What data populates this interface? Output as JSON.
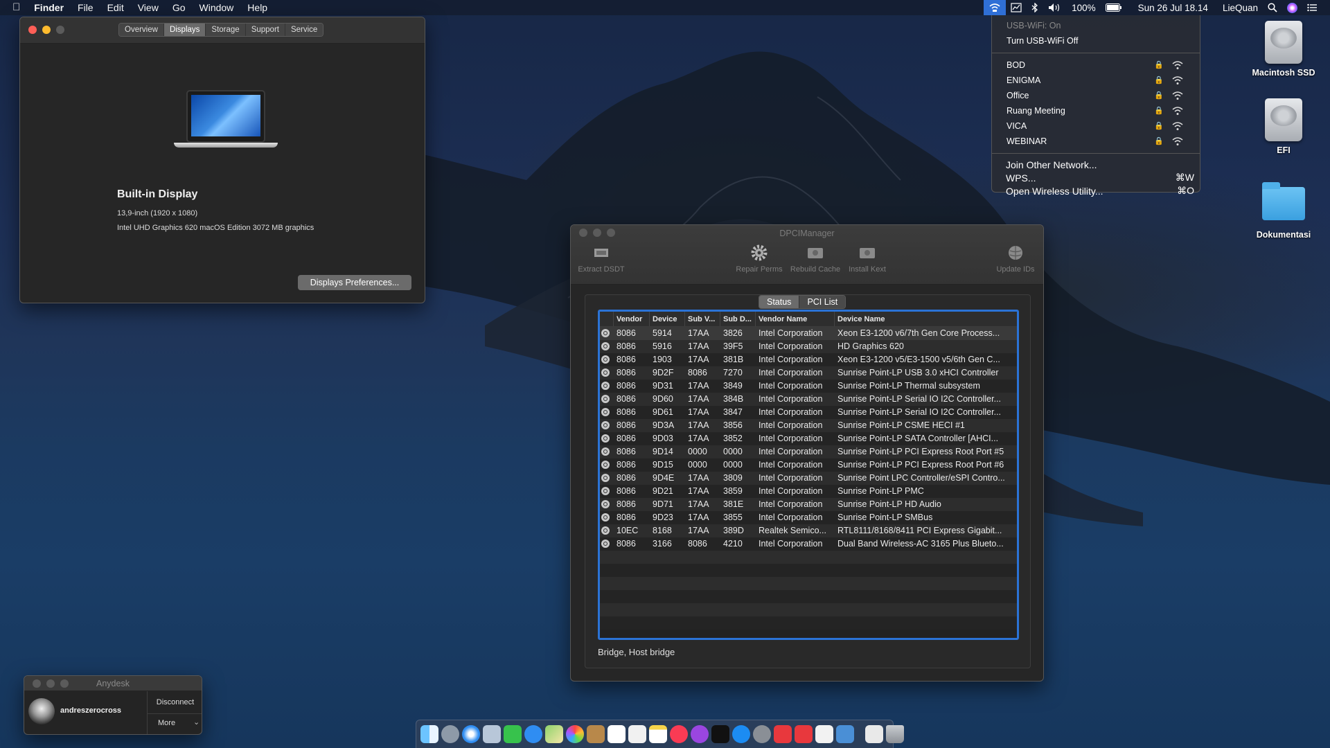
{
  "menubar": {
    "apple": "",
    "app_name": "Finder",
    "menus": [
      "File",
      "Edit",
      "View",
      "Go",
      "Window",
      "Help"
    ],
    "battery": "100%",
    "datetime": "Sun 26 Jul  18.14",
    "user": "LieQuan"
  },
  "wifi_menu": {
    "status": "USB-WiFi: On",
    "toggle": "Turn USB-WiFi Off",
    "networks": [
      "BOD",
      "ENIGMA",
      "Office",
      "Ruang Meeting",
      "VICA",
      "WEBINAR"
    ],
    "join_other": "Join Other Network...",
    "wps": "WPS...",
    "wps_shortcut": "⌘W",
    "open_utility": "Open Wireless Utility...",
    "utility_shortcut": "⌘O"
  },
  "desktop": {
    "icons": [
      "Macintosh SSD",
      "EFI",
      "Dokumentasi"
    ]
  },
  "about_window": {
    "tabs": [
      "Overview",
      "Displays",
      "Storage",
      "Support",
      "Service"
    ],
    "selected_tab": "Displays",
    "display_name": "Built-in Display",
    "display_size": "13,9-inch (1920 x 1080)",
    "graphics": "Intel UHD Graphics 620 macOS Edition 3072 MB graphics",
    "button": "Displays Preferences..."
  },
  "dpci": {
    "title": "DPCIManager",
    "toolbar": [
      "Extract DSDT",
      "Repair Perms",
      "Rebuild Cache",
      "Install Kext",
      "Update IDs"
    ],
    "tabs": [
      "Status",
      "PCI List"
    ],
    "columns": [
      "",
      "Vendor",
      "Device",
      "Sub V...",
      "Sub D...",
      "Vendor Name",
      "Device Name"
    ],
    "rows": [
      [
        "8086",
        "5914",
        "17AA",
        "3826",
        "Intel Corporation",
        "Xeon E3-1200 v6/7th Gen Core Process..."
      ],
      [
        "8086",
        "5916",
        "17AA",
        "39F5",
        "Intel Corporation",
        "HD Graphics 620"
      ],
      [
        "8086",
        "1903",
        "17AA",
        "381B",
        "Intel Corporation",
        "Xeon E3-1200 v5/E3-1500 v5/6th Gen C..."
      ],
      [
        "8086",
        "9D2F",
        "8086",
        "7270",
        "Intel Corporation",
        "Sunrise Point-LP USB 3.0 xHCI Controller"
      ],
      [
        "8086",
        "9D31",
        "17AA",
        "3849",
        "Intel Corporation",
        "Sunrise Point-LP Thermal subsystem"
      ],
      [
        "8086",
        "9D60",
        "17AA",
        "384B",
        "Intel Corporation",
        "Sunrise Point-LP Serial IO I2C Controller..."
      ],
      [
        "8086",
        "9D61",
        "17AA",
        "3847",
        "Intel Corporation",
        "Sunrise Point-LP Serial IO I2C Controller..."
      ],
      [
        "8086",
        "9D3A",
        "17AA",
        "3856",
        "Intel Corporation",
        "Sunrise Point-LP CSME HECI #1"
      ],
      [
        "8086",
        "9D03",
        "17AA",
        "3852",
        "Intel Corporation",
        "Sunrise Point-LP SATA Controller [AHCI..."
      ],
      [
        "8086",
        "9D14",
        "0000",
        "0000",
        "Intel Corporation",
        "Sunrise Point-LP PCI Express Root Port #5"
      ],
      [
        "8086",
        "9D15",
        "0000",
        "0000",
        "Intel Corporation",
        "Sunrise Point-LP PCI Express Root Port #6"
      ],
      [
        "8086",
        "9D4E",
        "17AA",
        "3809",
        "Intel Corporation",
        "Sunrise Point LPC Controller/eSPI Contro..."
      ],
      [
        "8086",
        "9D21",
        "17AA",
        "3859",
        "Intel Corporation",
        "Sunrise Point-LP PMC"
      ],
      [
        "8086",
        "9D71",
        "17AA",
        "381E",
        "Intel Corporation",
        "Sunrise Point-LP HD Audio"
      ],
      [
        "8086",
        "9D23",
        "17AA",
        "3855",
        "Intel Corporation",
        "Sunrise Point-LP SMBus"
      ],
      [
        "10EC",
        "8168",
        "17AA",
        "389D",
        "Realtek Semico...",
        "RTL8111/8168/8411 PCI Express Gigabit..."
      ],
      [
        "8086",
        "3166",
        "8086",
        "4210",
        "Intel Corporation",
        "Dual Band Wireless-AC 3165 Plus Blueto..."
      ]
    ],
    "status_text": "Bridge, Host bridge"
  },
  "anydesk": {
    "title": "Anydesk",
    "user": "andreszerocross",
    "disconnect": "Disconnect",
    "more": "More"
  }
}
